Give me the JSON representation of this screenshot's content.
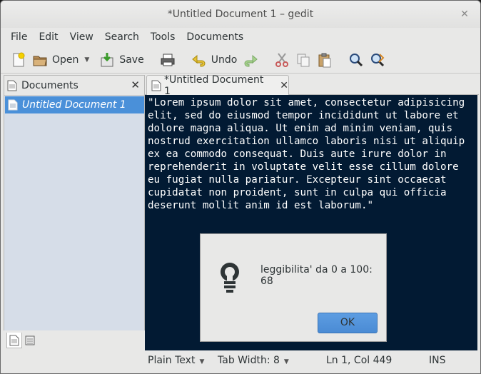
{
  "window": {
    "title": "*Untitled Document 1 – gedit"
  },
  "menubar": {
    "items": [
      "File",
      "Edit",
      "View",
      "Search",
      "Tools",
      "Documents"
    ]
  },
  "toolbar": {
    "open_label": "Open",
    "save_label": "Save",
    "undo_label": "Undo"
  },
  "sidepanel": {
    "title": "Documents",
    "documents": [
      "Untitled Document 1"
    ]
  },
  "tab": {
    "label": "*Untitled Document 1"
  },
  "editor": {
    "text": "\"Lorem ipsum dolor sit amet, consectetur adipisicing elit, sed do eiusmod tempor incididunt ut labore et dolore magna aliqua. Ut enim ad minim veniam, quis nostrud exercitation ullamco laboris nisi ut aliquip ex ea commodo consequat. Duis aute irure dolor in reprehenderit in voluptate velit esse cillum dolore eu fugiat nulla pariatur. Excepteur sint occaecat cupidatat non proident, sunt in culpa qui officia deserunt mollit anim id est laborum.\""
  },
  "statusbar": {
    "language": "Plain Text",
    "tab_width": "Tab Width: 8",
    "position": "Ln 1, Col 449",
    "mode": "INS"
  },
  "dialog": {
    "message": "leggibilita' da 0 a 100: 68",
    "ok_label": "OK"
  },
  "colors": {
    "editor_bg": "#021a33",
    "selection": "#4a90d9"
  }
}
